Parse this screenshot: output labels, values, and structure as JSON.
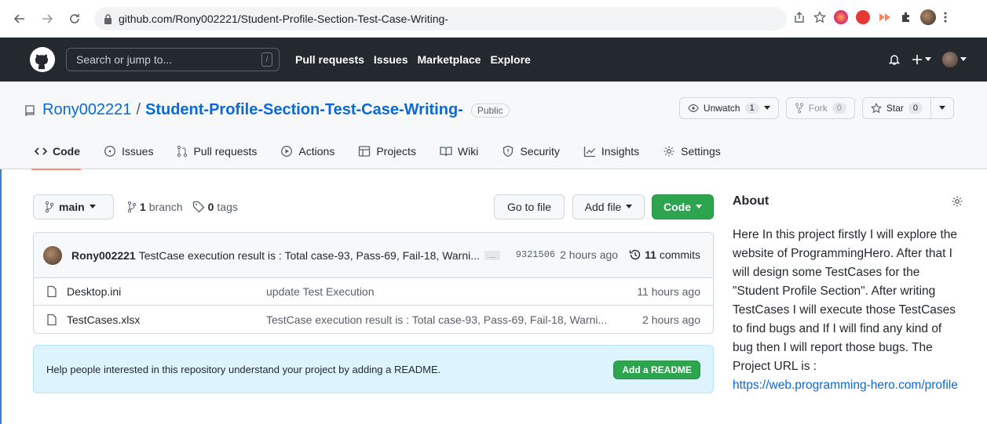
{
  "browser": {
    "url": "github.com/Rony002221/Student-Profile-Section-Test-Case-Writing-",
    "icons": [
      "back-icon",
      "forward-icon",
      "reload-icon",
      "lock-icon",
      "share-icon",
      "star-icon",
      "extensions-icon"
    ]
  },
  "header": {
    "search_placeholder": "Search or jump to...",
    "slash_key": "/",
    "nav": [
      "Pull requests",
      "Issues",
      "Marketplace",
      "Explore"
    ]
  },
  "repo": {
    "owner": "Rony002221",
    "separator": "/",
    "name": "Student-Profile-Section-Test-Case-Writing-",
    "visibility": "Public",
    "unwatch_label": "Unwatch",
    "unwatch_count": "1",
    "fork_label": "Fork",
    "fork_count": "0",
    "star_label": "Star",
    "star_count": "0"
  },
  "tabs": [
    {
      "label": "Code",
      "icon": "code-icon"
    },
    {
      "label": "Issues",
      "icon": "issue-icon"
    },
    {
      "label": "Pull requests",
      "icon": "pull-request-icon"
    },
    {
      "label": "Actions",
      "icon": "play-icon"
    },
    {
      "label": "Projects",
      "icon": "table-icon"
    },
    {
      "label": "Wiki",
      "icon": "book-icon"
    },
    {
      "label": "Security",
      "icon": "shield-icon"
    },
    {
      "label": "Insights",
      "icon": "graph-icon"
    },
    {
      "label": "Settings",
      "icon": "gear-icon"
    }
  ],
  "toolbar": {
    "branch": "main",
    "branch_count": "1",
    "branch_label": "branch",
    "tag_count": "0",
    "tag_label": "tags",
    "goto_file": "Go to file",
    "add_file": "Add file",
    "code": "Code"
  },
  "commit": {
    "author": "Rony002221",
    "message": "TestCase execution result is : Total case-93, Pass-69, Fail-18, Warni...",
    "ellipsis": "…",
    "sha": "9321506",
    "time": "2 hours ago",
    "commit_count": "11",
    "commit_label": "commits"
  },
  "files": [
    {
      "name": "Desktop.ini",
      "message": "update Test Execution",
      "time": "11 hours ago"
    },
    {
      "name": "TestCases.xlsx",
      "message": "TestCase execution result is : Total case-93, Pass-69, Fail-18, Warni...",
      "time": "2 hours ago"
    }
  ],
  "readme": {
    "text": "Help people interested in this repository understand your project by adding a README.",
    "button": "Add a README"
  },
  "about": {
    "title": "About",
    "description": "Here In this project firstly I will explore the website of ProgrammingHero. After that I will design some TestCases for the \"Student Profile Section\". After writing TestCases I will execute those TestCases to find bugs and If I will find any kind of bug then I will report those bugs. The Project URL is :",
    "link": "https://web.programming-hero.com/profile"
  },
  "colors": {
    "accent": "#0969da",
    "green": "#2da44e",
    "header": "#24292f"
  }
}
